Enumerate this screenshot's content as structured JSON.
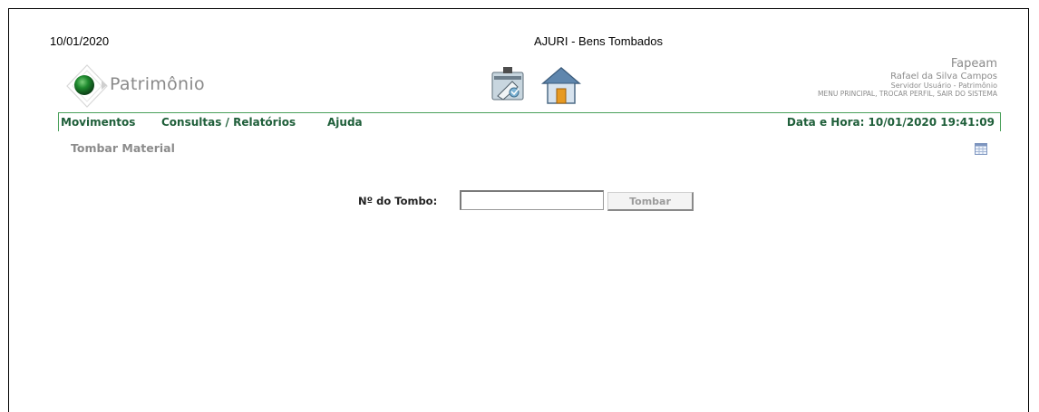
{
  "header": {
    "date": "10/01/2020",
    "app_title": "AJURI - Bens Tombados"
  },
  "logo": {
    "text": "Patrimônio"
  },
  "user": {
    "organization": "Fapeam",
    "name": "Rafael da Silva Campos",
    "profile": "Servidor Usuário - Patrimônio",
    "links": "MENU PRINCIPAL, TROCAR PERFIL, SAIR DO SISTEMA"
  },
  "menu": {
    "items": [
      "Movimentos",
      "Consultas / Relatórios",
      "Ajuda"
    ],
    "datetime": "Data e Hora: 10/01/2020 19:41:09"
  },
  "page": {
    "title": "Tombar Material"
  },
  "form": {
    "label": "Nº do Tombo:",
    "input_value": "",
    "button_label": "Tombar"
  },
  "colors": {
    "menu_text": "#1f5f3a",
    "menu_border": "#4aa05a",
    "muted_text": "#8c8c8c"
  }
}
